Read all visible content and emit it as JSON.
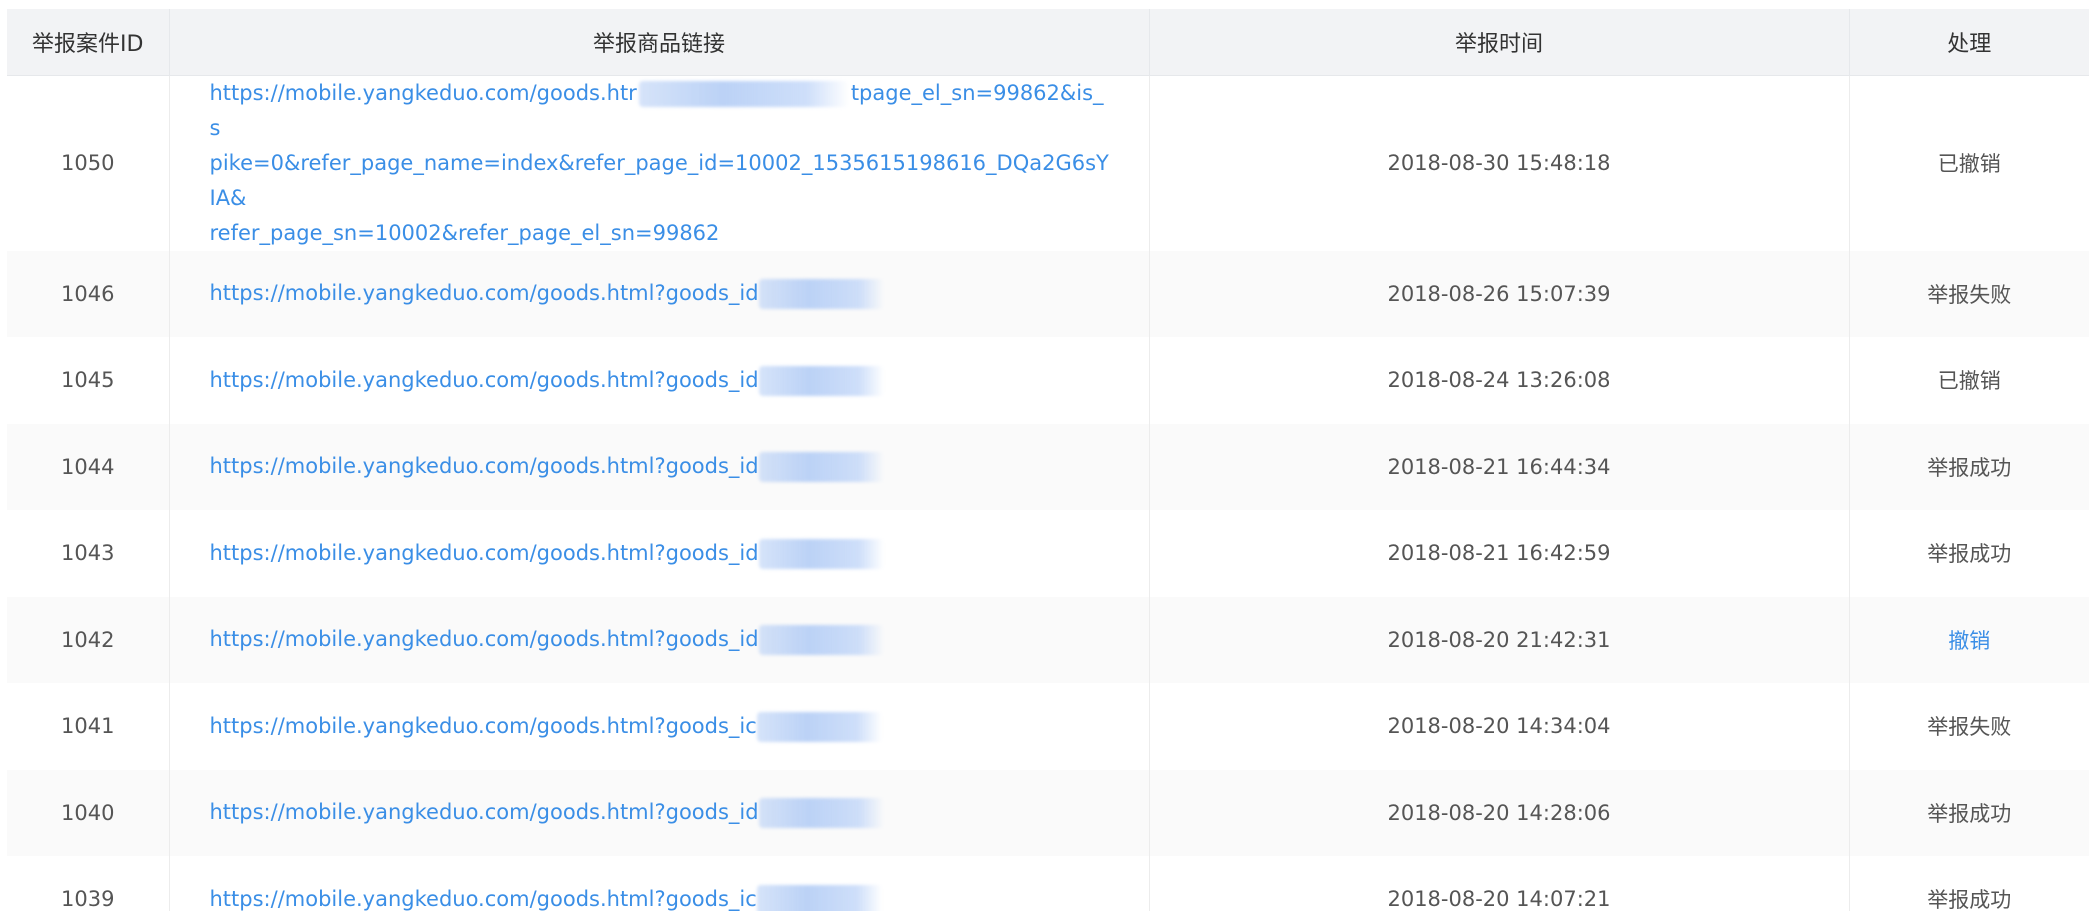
{
  "table": {
    "headers": {
      "id": "举报案件ID",
      "link": "举报商品链接",
      "time": "举报时间",
      "action": "处理"
    },
    "rows": [
      {
        "id": "1050",
        "link_part1": "https://mobile.yangkeduo.com/goods.htr",
        "link_part2": "tpage_el_sn=99862&is_s",
        "link_line2": "pike=0&refer_page_name=index&refer_page_id=10002_1535615198616_DQa2G6sYIA&",
        "link_line3": "refer_page_sn=10002&refer_page_el_sn=99862",
        "time": "2018-08-30 15:48:18",
        "status": "已撤销"
      },
      {
        "id": "1046",
        "link": "https://mobile.yangkeduo.com/goods.html?goods_id",
        "time": "2018-08-26 15:07:39",
        "status": "举报失败"
      },
      {
        "id": "1045",
        "link": "https://mobile.yangkeduo.com/goods.html?goods_id",
        "time": "2018-08-24 13:26:08",
        "status": "已撤销"
      },
      {
        "id": "1044",
        "link": "https://mobile.yangkeduo.com/goods.html?goods_id",
        "time": "2018-08-21 16:44:34",
        "status": "举报成功"
      },
      {
        "id": "1043",
        "link": "https://mobile.yangkeduo.com/goods.html?goods_id",
        "time": "2018-08-21 16:42:59",
        "status": "举报成功"
      },
      {
        "id": "1042",
        "link": "https://mobile.yangkeduo.com/goods.html?goods_id",
        "time": "2018-08-20 21:42:31",
        "status": "撤销"
      },
      {
        "id": "1041",
        "link": "https://mobile.yangkeduo.com/goods.html?goods_ic",
        "time": "2018-08-20 14:34:04",
        "status": "举报失败"
      },
      {
        "id": "1040",
        "link": "https://mobile.yangkeduo.com/goods.html?goods_id",
        "time": "2018-08-20 14:28:06",
        "status": "举报成功"
      },
      {
        "id": "1039",
        "link": "https://mobile.yangkeduo.com/goods.html?goods_ic",
        "time": "2018-08-20 14:07:21",
        "status": "举报成功"
      }
    ]
  },
  "colors": {
    "link": "#3a8ee6",
    "header_bg": "#f2f3f5",
    "alt_row_bg": "#fafafa",
    "text": "#555555"
  }
}
